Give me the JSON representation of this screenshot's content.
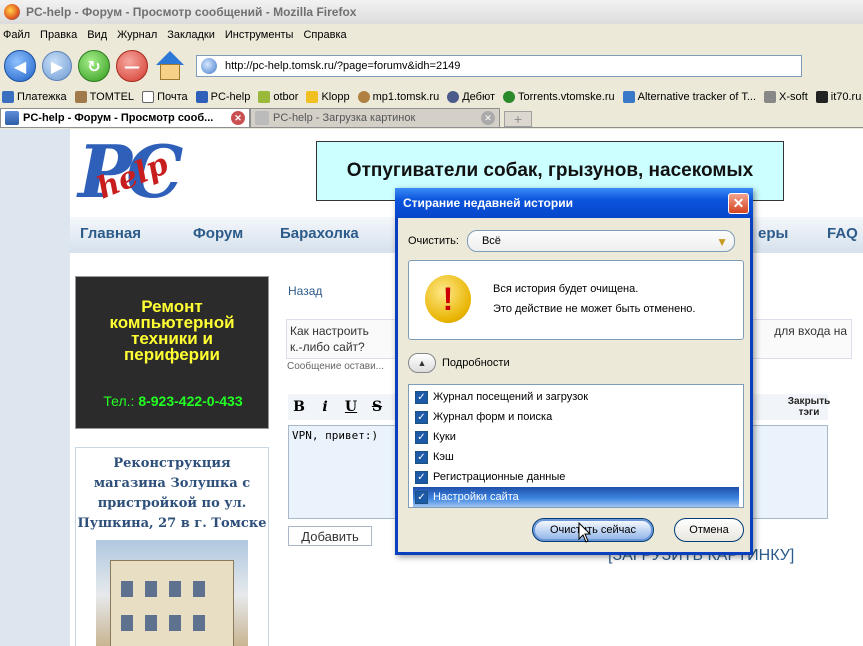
{
  "window": {
    "title": "PC-help - Форум - Просмотр сообщений - Mozilla Firefox"
  },
  "menu": {
    "items": [
      "Файл",
      "Правка",
      "Вид",
      "Журнал",
      "Закладки",
      "Инструменты",
      "Справка"
    ]
  },
  "navbar": {
    "url": "http://pc-help.tomsk.ru/?page=forumv&idh=2149"
  },
  "bookmarks": {
    "items": [
      "Платежка",
      "TOMTEL",
      "Почта",
      "PC-help",
      "otbor",
      "Klopp",
      "mp1.tomsk.ru",
      "Дебют",
      "Torrents.vtomske.ru",
      "Alternative tracker of T...",
      "X-soft",
      "it70.ru"
    ]
  },
  "tabs": [
    {
      "label": "PC-help - Форум - Просмотр сооб..."
    },
    {
      "label": "PC-help - Загрузка картинок"
    }
  ],
  "page": {
    "banner": "Отпугиватели собак, грызунов, насекомых",
    "nav": [
      "Главная",
      "Форум",
      "Барахолка",
      "еры",
      "FAQ"
    ],
    "promo": {
      "lines": [
        "Ремонт",
        "компьютерной",
        "техники и",
        "периферии"
      ],
      "tel_label": "Тел.:",
      "tel_number": "8-923-422-0-433"
    },
    "sidebox": {
      "text": "Реконструкция магазина Золушка с пристройкой по ул. Пушкина, 27 в г. Томске"
    },
    "back_link": "Назад",
    "question_left": "Как настроить ",
    "question_right": "для входа на",
    "question_line2": "к.-либо сайт?",
    "message_meta": "Сообщение остави...",
    "editor_buttons": [
      "B",
      "i",
      "U",
      "S"
    ],
    "close_tags": "Закрыть тэги",
    "editor_text": "VPN, привет:)",
    "add_button": "Добавить",
    "upload_link": "[ЗАГРУЗИТЬ КАРТИНКУ]"
  },
  "dialog": {
    "title": "Стирание недавней истории",
    "close_label": "✕",
    "clear_label": "Очистить:",
    "clear_value": "Всё",
    "warning_line1": "Вся история будет очищена.",
    "warning_line2": "Это действие не может быть отменено.",
    "details_label": "Подробности",
    "checklist": [
      {
        "label": "Журнал посещений и загрузок",
        "checked": true
      },
      {
        "label": "Журнал форм и поиска",
        "checked": true
      },
      {
        "label": "Куки",
        "checked": true
      },
      {
        "label": "Кэш",
        "checked": true
      },
      {
        "label": "Регистрационные данные",
        "checked": true
      },
      {
        "label": "Настройки сайта",
        "checked": true
      }
    ],
    "clear_button": "Очистить сейчас",
    "cancel_button": "Отмена"
  }
}
